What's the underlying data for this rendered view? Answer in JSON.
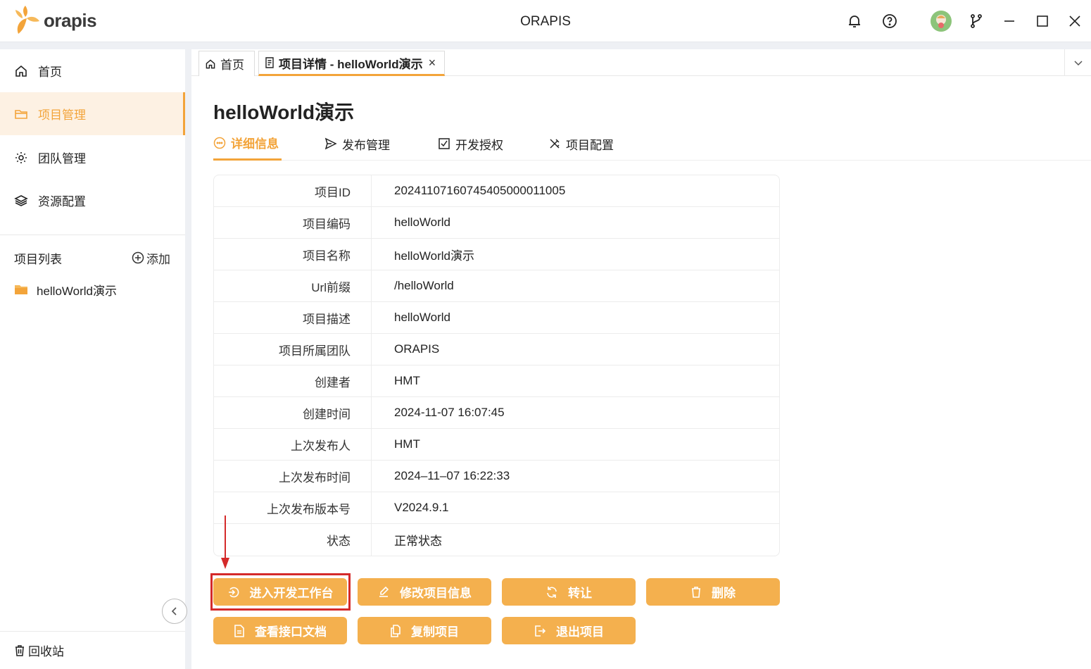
{
  "titlebar": {
    "logo_text": "orapis",
    "app_title": "ORAPIS"
  },
  "sidebar": {
    "nav": [
      {
        "label": "首页",
        "icon": "home-icon"
      },
      {
        "label": "项目管理",
        "icon": "folder-icon"
      },
      {
        "label": "团队管理",
        "icon": "gear-icon"
      },
      {
        "label": "资源配置",
        "icon": "layers-icon"
      }
    ],
    "project_list_title": "项目列表",
    "add_label": "添加",
    "projects": [
      {
        "label": "helloWorld演示"
      }
    ],
    "recycle_label": "回收站"
  },
  "tabs": [
    {
      "label": "首页"
    },
    {
      "label": "项目详情 - helloWorld演示"
    }
  ],
  "page": {
    "title": "helloWorld演示",
    "subtabs": [
      {
        "label": "详细信息"
      },
      {
        "label": "发布管理"
      },
      {
        "label": "开发授权"
      },
      {
        "label": "项目配置"
      }
    ]
  },
  "details": [
    {
      "label": "项目ID",
      "value": "20241107160745405000011005"
    },
    {
      "label": "项目编码",
      "value": "helloWorld"
    },
    {
      "label": "项目名称",
      "value": "helloWorld演示"
    },
    {
      "label": "Url前缀",
      "value": "/helloWorld"
    },
    {
      "label": "项目描述",
      "value": "helloWorld"
    },
    {
      "label": "项目所属团队",
      "value": "ORAPIS"
    },
    {
      "label": "创建者",
      "value": "HMT"
    },
    {
      "label": "创建时间",
      "value": "2024-11-07 16:07:45"
    },
    {
      "label": "上次发布人",
      "value": "HMT"
    },
    {
      "label": "上次发布时间",
      "value": "2024–11–07 16:22:33"
    },
    {
      "label": "上次发布版本号",
      "value": "V2024.9.1"
    },
    {
      "label": "状态",
      "value": "正常状态"
    }
  ],
  "actions": [
    {
      "label": "进入开发工作台"
    },
    {
      "label": "修改项目信息"
    },
    {
      "label": "转让"
    },
    {
      "label": "删除"
    },
    {
      "label": "查看接口文档"
    },
    {
      "label": "复制项目"
    },
    {
      "label": "退出项目"
    }
  ],
  "colors": {
    "accent": "#f3a43a",
    "button": "#f4b04e",
    "highlight": "#d42a2a"
  }
}
